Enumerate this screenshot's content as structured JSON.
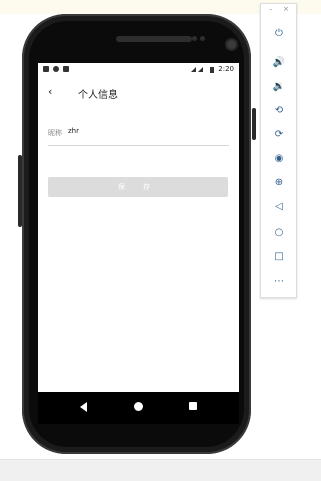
{
  "status_bar": {
    "time": "2:20"
  },
  "app_bar": {
    "back_icon": "‹",
    "title": "个人信息"
  },
  "form": {
    "nickname_label": "昵称",
    "nickname_value": "zhr"
  },
  "save_button": {
    "label": "保 存"
  },
  "toolbar": {
    "minimize": "–",
    "close": "×",
    "icons": {
      "power": "⏻",
      "volume_up": "🔊",
      "volume_down": "🔉",
      "rotate_left": "⟲",
      "rotate_right": "⟳",
      "screenshot": "◉",
      "zoom": "⊕",
      "back": "◁",
      "home": "○",
      "overview": "□",
      "more": "⋯"
    }
  },
  "colors": {
    "button_bg": "#dcdcdc",
    "toolbar_icon": "#2f5f8a",
    "phone_body": "#1b1b1b"
  }
}
